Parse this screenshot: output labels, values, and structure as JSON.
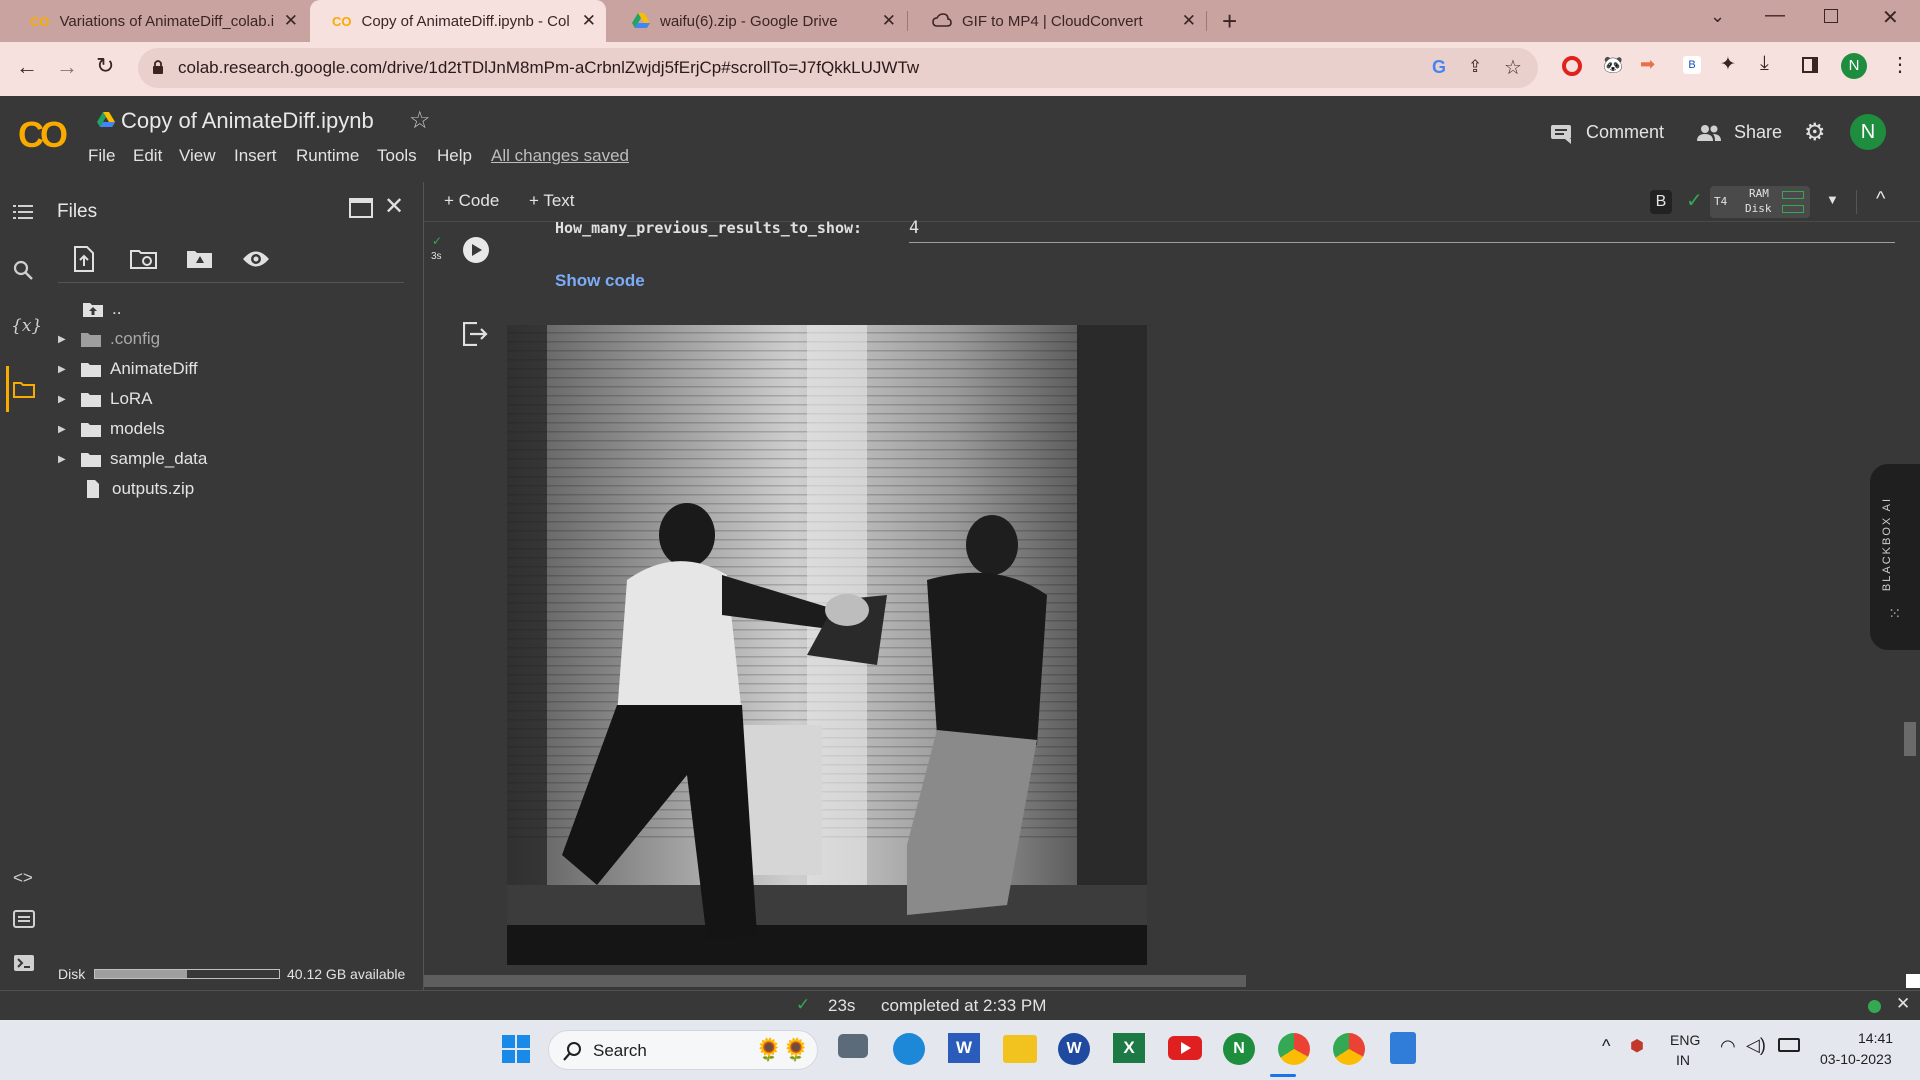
{
  "browser": {
    "tabs": [
      {
        "title": "Variations of AnimateDiff_colab.i",
        "active": false
      },
      {
        "title": "Copy of AnimateDiff.ipynb - Col",
        "active": true
      },
      {
        "title": "waifu(6).zip - Google Drive",
        "active": false
      },
      {
        "title": "GIF to MP4 | CloudConvert",
        "active": false
      }
    ],
    "url": "colab.research.google.com/drive/1d2tTDlJnM8mPm-aCrbnlZwjdj5fErjCp#scrollTo=J7fQkkLUJWTw",
    "profile_initial": "N"
  },
  "colab": {
    "logo": "CO",
    "filename": "Copy of AnimateDiff.ipynb",
    "menu": [
      "File",
      "Edit",
      "View",
      "Insert",
      "Runtime",
      "Tools",
      "Help"
    ],
    "saved_status": "All changes saved",
    "comment_label": "Comment",
    "share_label": "Share",
    "avatar_initial": "N",
    "add_code_label": "+ Code",
    "add_text_label": "+ Text",
    "runtime_badge": "B",
    "gpu_label": "T4",
    "ram_label": "RAM",
    "disk_label": "Disk"
  },
  "files_panel": {
    "title": "Files",
    "items": [
      {
        "name": "..",
        "type": "up"
      },
      {
        "name": ".config",
        "type": "folder"
      },
      {
        "name": "AnimateDiff",
        "type": "folder"
      },
      {
        "name": "LoRA",
        "type": "folder"
      },
      {
        "name": "models",
        "type": "folder"
      },
      {
        "name": "sample_data",
        "type": "folder"
      },
      {
        "name": "outputs.zip",
        "type": "file"
      }
    ],
    "disk_label": "Disk",
    "disk_available": "40.12 GB available",
    "disk_used_fraction": 0.5
  },
  "cell": {
    "exec_time": "3s",
    "form_field_label": "How_many_previous_results_to_show:",
    "form_field_value": "4",
    "show_code_label": "Show code"
  },
  "statusbar": {
    "duration": "23s",
    "completed": "completed at 2:33 PM"
  },
  "extension": {
    "label": "BLACKBOX AI"
  },
  "taskbar": {
    "search_placeholder": "Search",
    "lang_top": "ENG",
    "lang_bottom": "IN",
    "time": "14:41",
    "date": "03-10-2023"
  },
  "colors": {
    "colab_orange": "#f9ab00",
    "link_blue": "#7cacf8",
    "green": "#34a853"
  }
}
